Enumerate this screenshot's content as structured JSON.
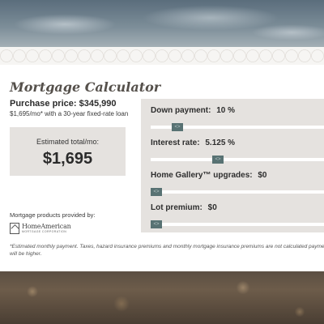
{
  "title": "Mortgage Calculator",
  "purchase": {
    "label": "Purchase price:",
    "value": "$345,990",
    "sub": "$1,695/mo* with a 30-year fixed-rate loan"
  },
  "estimate": {
    "label": "Estimated total/mo:",
    "value": "$1,695"
  },
  "sliders": [
    {
      "label": "Down payment:",
      "value": "10 %",
      "fraction": 0.13
    },
    {
      "label": "Interest rate:",
      "value": "5.125 %",
      "fraction": 0.38
    },
    {
      "label": "Home Gallery™ upgrades:",
      "value": "$0",
      "fraction": 0.0
    },
    {
      "label": "Lot premium:",
      "value": "$0",
      "fraction": 0.0
    }
  ],
  "slider_thumb_glyph": "<>",
  "provider": {
    "label": "Mortgage products provided by:",
    "logo_name": "HomeAmerican",
    "logo_sub": "MORTGAGE CORPORATION"
  },
  "footnote": "*Estimated monthly payment. Taxes, hazard insurance premiums and monthly mortgage insurance premiums are not calculated payment will be higher.",
  "colors": {
    "thumb": "#587273",
    "panel": "#e5e2df"
  }
}
